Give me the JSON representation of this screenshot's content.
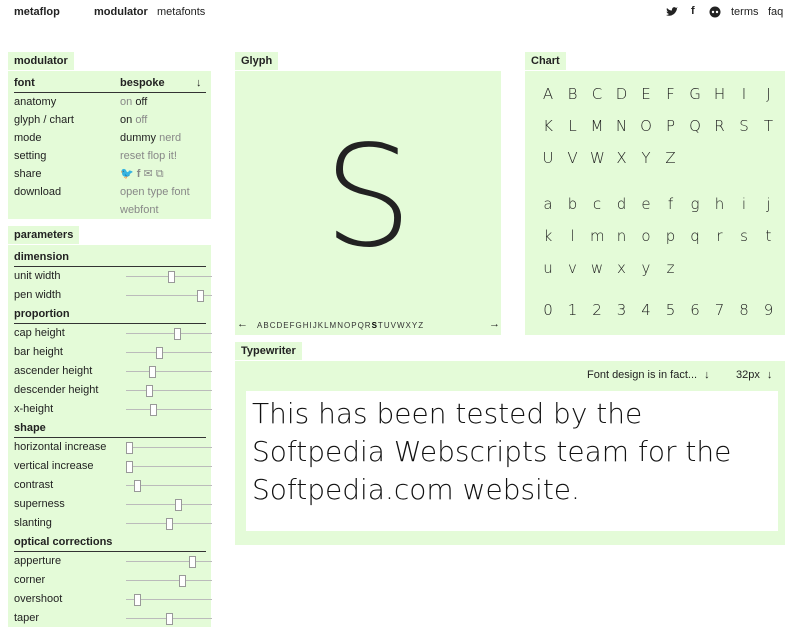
{
  "header": {
    "logo": "metaflop",
    "nav": [
      "modulator",
      "metafonts"
    ],
    "links": {
      "terms": "terms",
      "faq": "faq"
    },
    "icons": [
      "twitter-icon",
      "facebook-icon",
      "github-icon"
    ]
  },
  "modulator": {
    "tab": "modulator",
    "font_label": "font",
    "font_value": "bespoke",
    "rows": [
      {
        "label": "anatomy",
        "options": [
          "on",
          "off"
        ],
        "active": 1
      },
      {
        "label": "glyph / chart",
        "options": [
          "on",
          "off"
        ],
        "active": 0
      },
      {
        "label": "mode",
        "options": [
          "dummy",
          "nerd"
        ],
        "active": 0
      },
      {
        "label": "setting",
        "options": [
          "reset",
          "flop it!"
        ],
        "active": -1
      }
    ],
    "share_label": "share",
    "download_label": "download",
    "download_options": [
      "open type font",
      "webfont"
    ]
  },
  "parameters": {
    "tab": "parameters",
    "sections": [
      {
        "title": "dimension",
        "items": [
          {
            "label": "unit width",
            "value": 0.52
          },
          {
            "label": "pen width",
            "value": 0.86
          }
        ]
      },
      {
        "title": "proportion",
        "items": [
          {
            "label": "cap height",
            "value": 0.59
          },
          {
            "label": "bar height",
            "value": 0.38
          },
          {
            "label": "ascender height",
            "value": 0.3
          },
          {
            "label": "descender height",
            "value": 0.27
          },
          {
            "label": "x-height",
            "value": 0.31
          }
        ]
      },
      {
        "title": "shape",
        "items": [
          {
            "label": "horizontal increase",
            "value": 0.04
          },
          {
            "label": "vertical increase",
            "value": 0.04
          },
          {
            "label": "contrast",
            "value": 0.13
          },
          {
            "label": "superness",
            "value": 0.61
          },
          {
            "label": "slanting",
            "value": 0.5
          }
        ]
      },
      {
        "title": "optical corrections",
        "items": [
          {
            "label": "apperture",
            "value": 0.77
          },
          {
            "label": "corner",
            "value": 0.65
          },
          {
            "label": "overshoot",
            "value": 0.13
          },
          {
            "label": "taper",
            "value": 0.5
          }
        ]
      }
    ]
  },
  "glyph": {
    "tab": "Glyph",
    "char": "S",
    "prev": "←",
    "next": "→",
    "alphabet": "ABCDEFGHIJKLMNOPQRSTUVWXYZ",
    "selected": "S"
  },
  "chart": {
    "tab": "Chart",
    "rows": [
      [
        "A",
        "B",
        "C",
        "D",
        "E",
        "F",
        "G",
        "H",
        "I",
        "J"
      ],
      [
        "K",
        "L",
        "M",
        "N",
        "O",
        "P",
        "Q",
        "R",
        "S",
        "T"
      ],
      [
        "U",
        "V",
        "W",
        "X",
        "Y",
        "Z"
      ],
      [
        "a",
        "b",
        "c",
        "d",
        "e",
        "f",
        "g",
        "h",
        "i",
        "j"
      ],
      [
        "k",
        "l",
        "m",
        "n",
        "o",
        "p",
        "q",
        "r",
        "s",
        "t"
      ],
      [
        "u",
        "v",
        "w",
        "x",
        "y",
        "z"
      ],
      [
        "0",
        "1",
        "2",
        "3",
        "4",
        "5",
        "6",
        "7",
        "8",
        "9"
      ]
    ]
  },
  "typewriter": {
    "tab": "Typewriter",
    "preset": "Font design is in fact...",
    "size": "32px",
    "text": "This has been tested by the Softpedia Webscripts team for the Softpedia.com website."
  },
  "colors": {
    "panel": "#e4fbd8"
  }
}
